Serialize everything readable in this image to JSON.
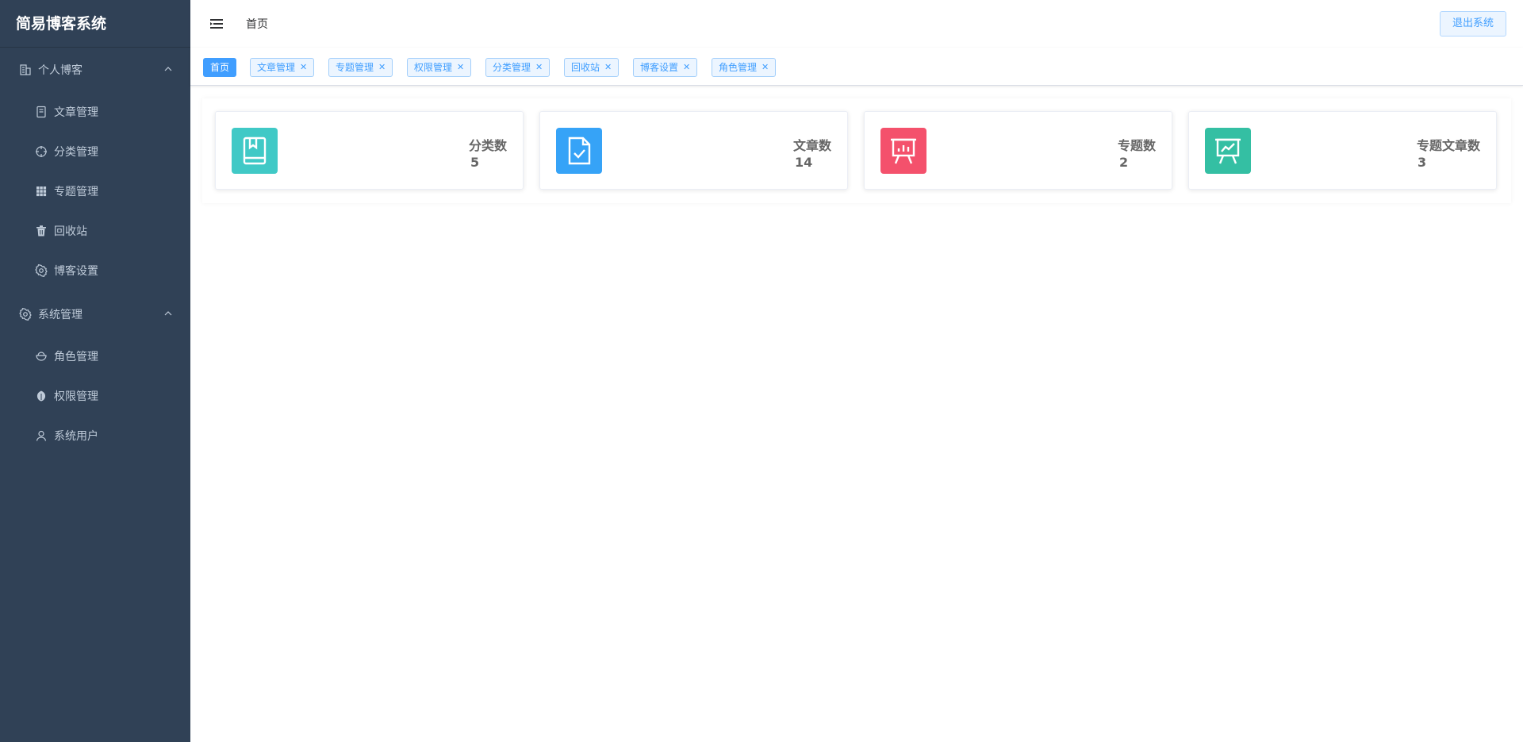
{
  "app": {
    "title": "简易博客系统"
  },
  "sidebar": {
    "groups": [
      {
        "label": "个人博客",
        "icon": "building-icon",
        "items": [
          {
            "label": "文章管理",
            "icon": "notebook-icon"
          },
          {
            "label": "分类管理",
            "icon": "crosshair-icon"
          },
          {
            "label": "专题管理",
            "icon": "grid-icon"
          },
          {
            "label": "回收站",
            "icon": "trash-icon"
          },
          {
            "label": "博客设置",
            "icon": "gear-icon"
          }
        ]
      },
      {
        "label": "系统管理",
        "icon": "gear-icon",
        "items": [
          {
            "label": "角色管理",
            "icon": "bowl-icon"
          },
          {
            "label": "权限管理",
            "icon": "leaf-icon"
          },
          {
            "label": "系统用户",
            "icon": "user-icon"
          }
        ]
      }
    ]
  },
  "header": {
    "breadcrumb": "首页",
    "logout_label": "退出系统"
  },
  "tags": [
    {
      "label": "首页",
      "active": true
    },
    {
      "label": "文章管理",
      "closable": true
    },
    {
      "label": "专题管理",
      "closable": true
    },
    {
      "label": "权限管理",
      "closable": true
    },
    {
      "label": "分类管理",
      "closable": true
    },
    {
      "label": "回收站",
      "closable": true
    },
    {
      "label": "博客设置",
      "closable": true
    },
    {
      "label": "角色管理",
      "closable": true
    }
  ],
  "cards": [
    {
      "label": "分类数",
      "value": "5",
      "color": "#40c9c6",
      "icon": "book-icon"
    },
    {
      "label": "文章数",
      "value": "14",
      "color": "#36a3f7",
      "icon": "document-check-icon"
    },
    {
      "label": "专题数",
      "value": "2",
      "color": "#f4516c",
      "icon": "presentation-bar-icon"
    },
    {
      "label": "专题文章数",
      "value": "3",
      "color": "#34bfa3",
      "icon": "presentation-line-icon"
    }
  ],
  "colors": {
    "sidebar_bg": "#304156",
    "sidebar_text": "#bfcbd9",
    "accent": "#409eff"
  }
}
